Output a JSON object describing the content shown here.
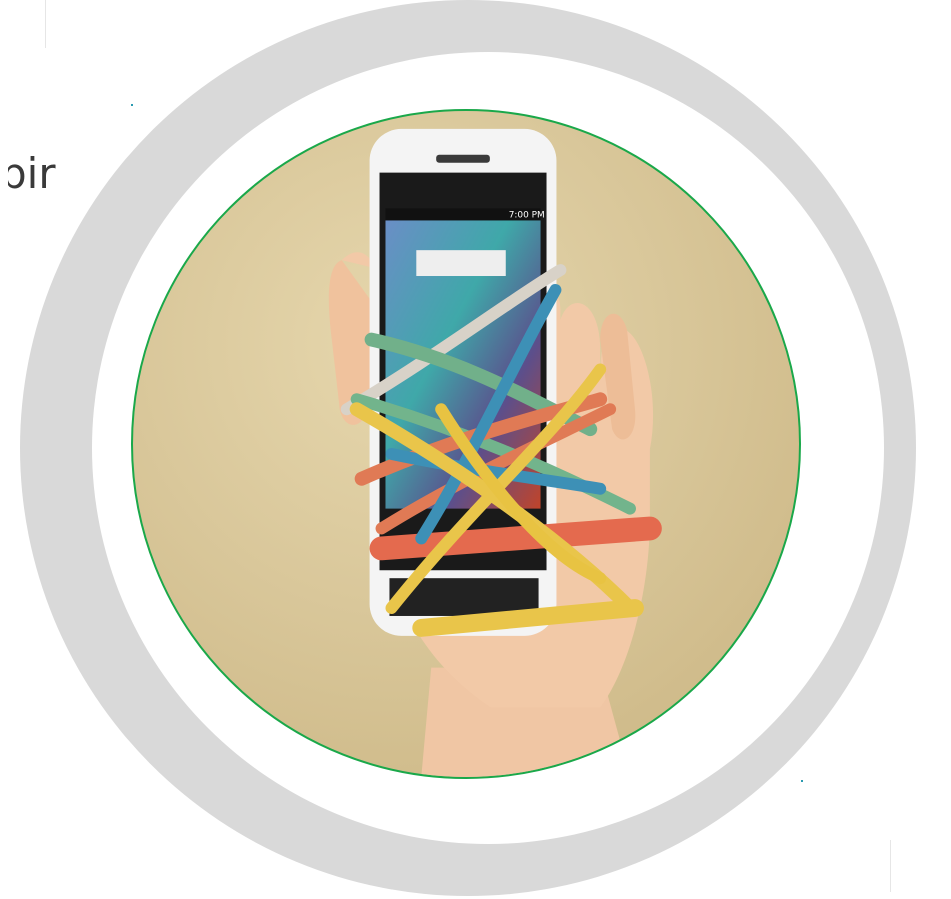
{
  "page": {
    "partial_heading": "bir"
  },
  "photo": {
    "phone_status_time": "7:00 PM"
  },
  "colors": {
    "ring": "#d9d9d9",
    "photo_border": "#1aa84a",
    "heading_text": "#3a3a3a",
    "background": "#ffffff"
  }
}
